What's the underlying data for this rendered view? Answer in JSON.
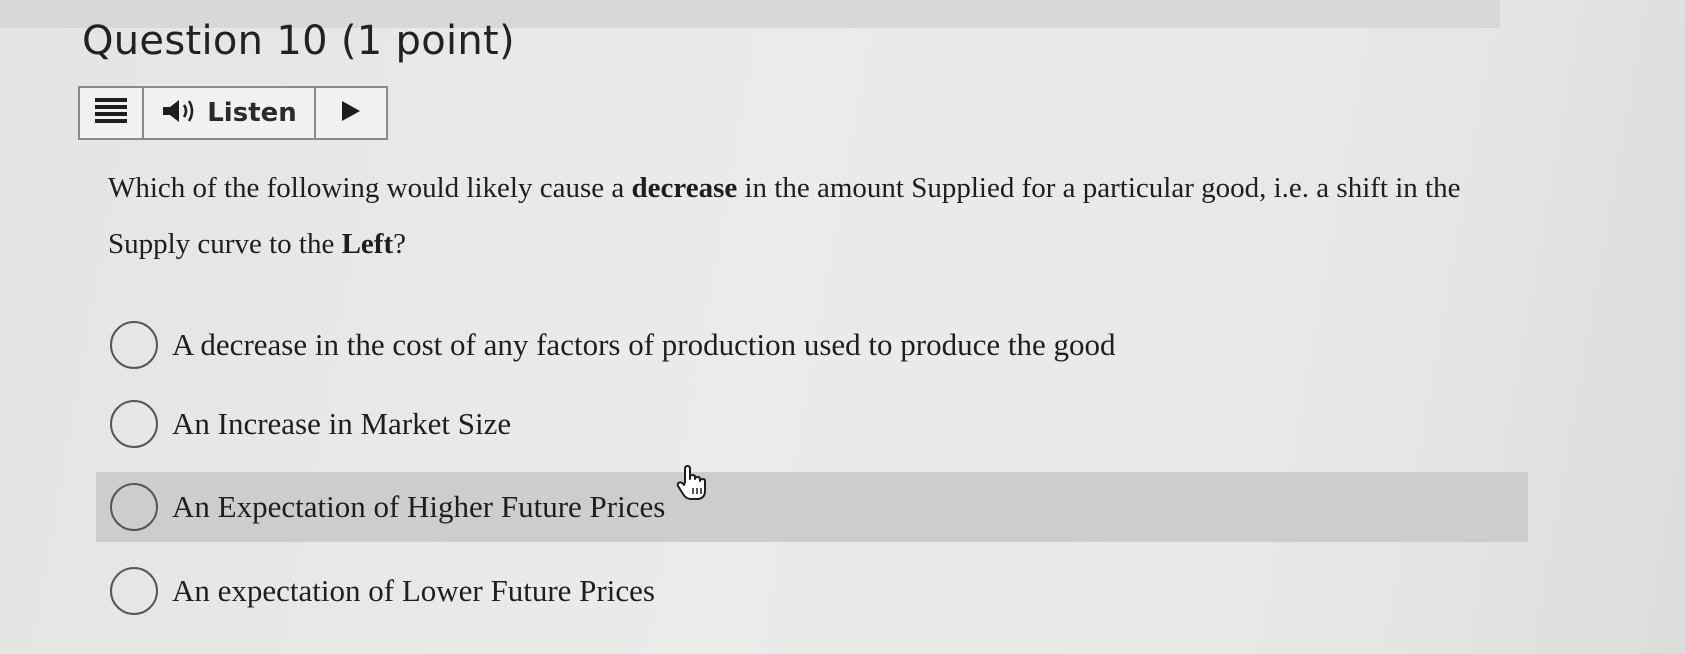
{
  "question": {
    "title": "Question 10 (1 point)"
  },
  "listen_toolbar": {
    "menu_icon": "hamburger-menu-icon",
    "speaker_icon": "speaker-icon",
    "label": "Listen",
    "play_icon": "play-icon"
  },
  "prompt": {
    "part1": "Which of the following would likely cause a ",
    "bold1": "decrease",
    "part2": " in the amount Supplied for a particular good, i.e. a shift in the Supply curve to the ",
    "bold2": "Left",
    "part3": "?"
  },
  "options": [
    {
      "label": "A decrease in the cost of any factors of production used to produce the good"
    },
    {
      "label": "An Increase in Market Size"
    },
    {
      "label": "An Expectation of Higher Future Prices"
    },
    {
      "label": "An expectation of Lower Future Prices"
    }
  ],
  "colors": {
    "page_background": "#e8e8e6",
    "hover_row": "#cdcdcb",
    "text": "#1e1e1e"
  },
  "cursor_icon": "hand-pointer-icon"
}
